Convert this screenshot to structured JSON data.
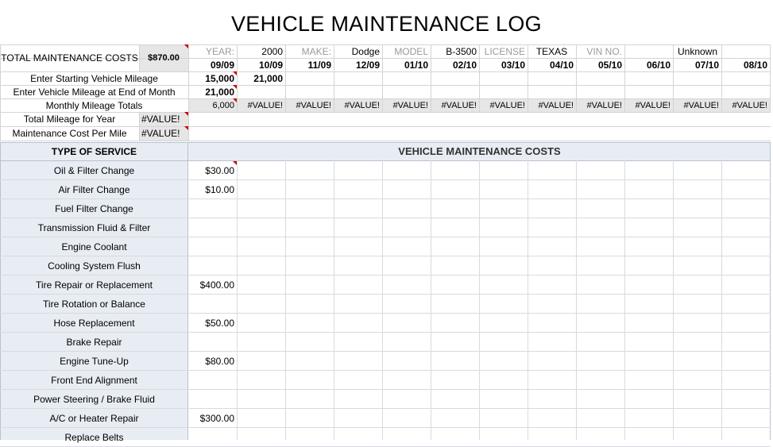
{
  "title": "VEHICLE MAINTENANCE LOG",
  "summary": {
    "total_label": "TOTAL MAINTENANCE COSTS",
    "total_value": "$870.00"
  },
  "vehicle": {
    "year_label": "YEAR:",
    "year_value": "2000",
    "make_label": "MAKE:",
    "make_value": "Dodge",
    "model_label": "MODEL",
    "model_value": "B-3500",
    "license_label": "LICENSE",
    "license_value": "TEXAS",
    "vin_label": "VIN NO.",
    "vin_value": "Unknown"
  },
  "months": [
    "09/09",
    "10/09",
    "11/09",
    "12/09",
    "01/10",
    "02/10",
    "03/10",
    "04/10",
    "05/10",
    "06/10",
    "07/10",
    "08/10"
  ],
  "mileage": {
    "start_label": "Enter Starting Vehicle Mileage",
    "start_values": [
      "15,000",
      "21,000",
      "",
      "",
      "",
      "",
      "",
      "",
      "",
      "",
      "",
      ""
    ],
    "end_label": "Enter Vehicle Mileage at End of Month",
    "end_values": [
      "21,000",
      "",
      "",
      "",
      "",
      "",
      "",
      "",
      "",
      "",
      "",
      ""
    ],
    "monthly_label": "Monthly Mileage Totals",
    "monthly_values": [
      "6,000",
      "#VALUE!",
      "#VALUE!",
      "#VALUE!",
      "#VALUE!",
      "#VALUE!",
      "#VALUE!",
      "#VALUE!",
      "#VALUE!",
      "#VALUE!",
      "#VALUE!",
      "#VALUE!"
    ],
    "year_total_label": "Total Mileage for Year",
    "year_total_value": "#VALUE!",
    "cost_per_mile_label": "Maintenance Cost Per Mile",
    "cost_per_mile_value": "#VALUE!"
  },
  "services": {
    "header": "TYPE OF SERVICE",
    "costs_header": "VEHICLE MAINTENANCE COSTS",
    "rows": [
      {
        "label": "Oil & Filter Change",
        "first": "$30.00"
      },
      {
        "label": "Air Filter Change",
        "first": "$10.00"
      },
      {
        "label": "Fuel Filter Change",
        "first": ""
      },
      {
        "label": "Transmission Fluid & Filter",
        "first": ""
      },
      {
        "label": "Engine Coolant",
        "first": ""
      },
      {
        "label": "Cooling System Flush",
        "first": ""
      },
      {
        "label": "Tire Repair or Replacement",
        "first": "$400.00"
      },
      {
        "label": "Tire Rotation or Balance",
        "first": ""
      },
      {
        "label": "Hose Replacement",
        "first": "$50.00"
      },
      {
        "label": "Brake Repair",
        "first": ""
      },
      {
        "label": "Engine Tune-Up",
        "first": "$80.00"
      },
      {
        "label": "Front End Alignment",
        "first": ""
      },
      {
        "label": "Power Steering / Brake Fluid",
        "first": ""
      },
      {
        "label": "A/C or Heater Repair",
        "first": "$300.00"
      },
      {
        "label": "Replace Belts",
        "first": ""
      }
    ]
  }
}
